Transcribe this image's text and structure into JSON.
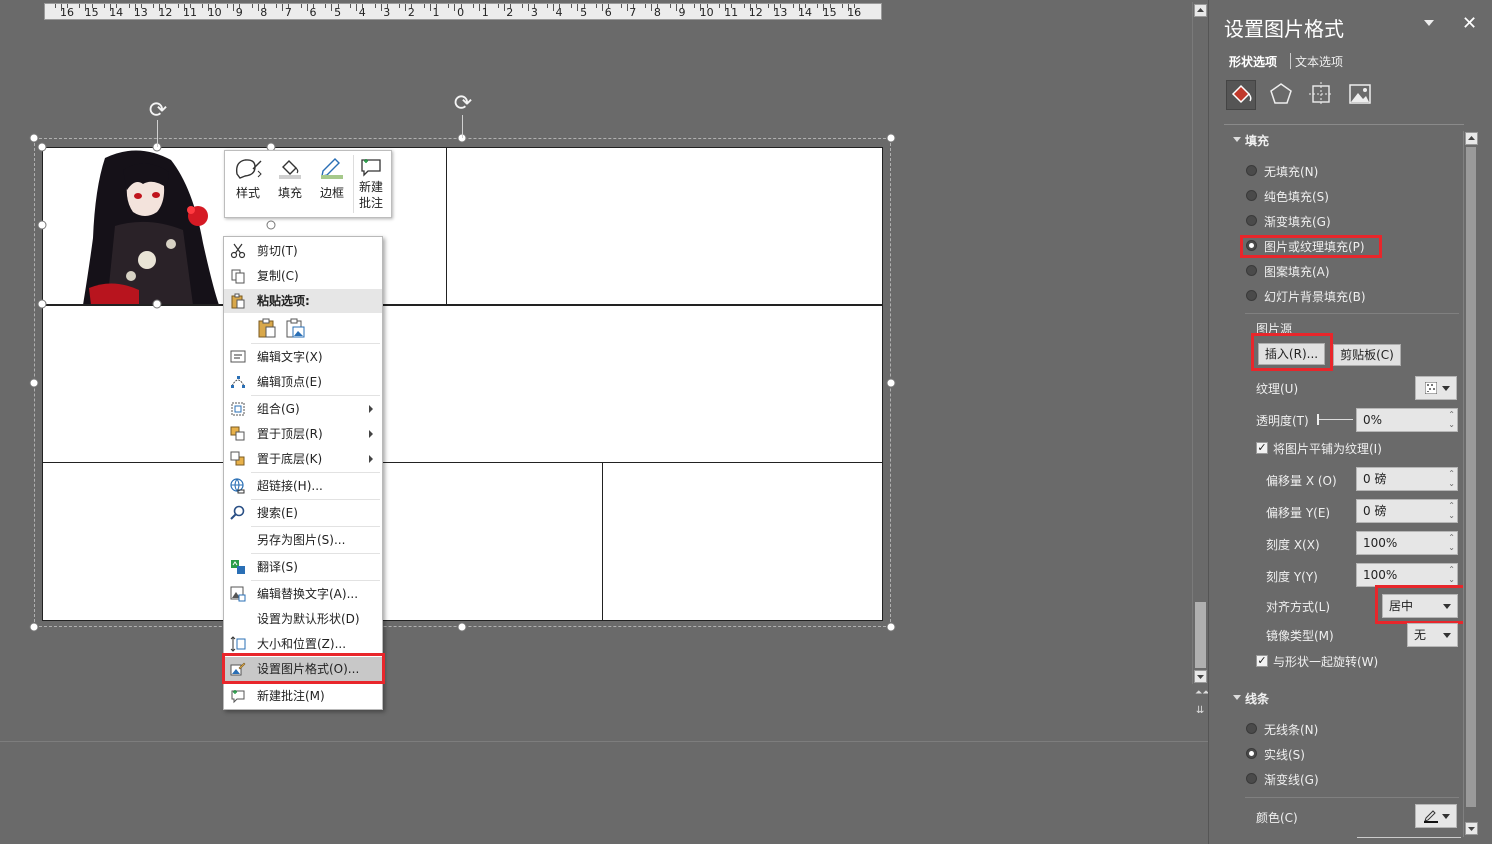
{
  "ruler": {
    "labels": [
      "16",
      "15",
      "14",
      "13",
      "12",
      "11",
      "10",
      "9",
      "8",
      "7",
      "6",
      "5",
      "4",
      "3",
      "2",
      "1",
      "0",
      "1",
      "2",
      "3",
      "4",
      "5",
      "6",
      "7",
      "8",
      "9",
      "10",
      "11",
      "12",
      "13",
      "14",
      "15",
      "16"
    ]
  },
  "mini_toolbar": {
    "style": "样式",
    "fill": "填充",
    "border": "边框",
    "comment_line1": "新建",
    "comment_line2": "批注"
  },
  "context_menu": {
    "cut": "剪切(T)",
    "copy": "复制(C)",
    "paste_options": "粘贴选项:",
    "edit_text": "编辑文字(X)",
    "edit_points": "编辑顶点(E)",
    "group": "组合(G)",
    "bring_front": "置于顶层(R)",
    "send_back": "置于底层(K)",
    "hyperlink": "超链接(H)...",
    "search": "搜索(E)",
    "save_as_picture": "另存为图片(S)...",
    "translate": "翻译(S)",
    "edit_alt_text": "编辑替换文字(A)...",
    "set_default_shape": "设置为默认形状(D)",
    "size_position": "大小和位置(Z)...",
    "format_picture": "设置图片格式(O)...",
    "new_comment": "新建批注(M)"
  },
  "pane": {
    "title": "设置图片格式",
    "tab_shape": "形状选项",
    "tab_text": "文本选项",
    "fill_section": "填充",
    "fill_options": [
      "无填充(N)",
      "纯色填充(S)",
      "渐变填充(G)",
      "图片或纹理填充(P)",
      "图案填充(A)",
      "幻灯片背景填充(B)"
    ],
    "picture_source": "图片源",
    "insert_button": "插入(R)...",
    "clipboard_button": "剪贴板(C)",
    "texture_label": "纹理(U)",
    "transparency_label": "透明度(T)",
    "transparency_value": "0%",
    "tile_label": "将图片平铺为纹理(I)",
    "offset_x_label": "偏移量 X (O)",
    "offset_x_value": "0 磅",
    "offset_y_label": "偏移量 Y(E)",
    "offset_y_value": "0 磅",
    "scale_x_label": "刻度 X(X)",
    "scale_x_value": "100%",
    "scale_y_label": "刻度 Y(Y)",
    "scale_y_value": "100%",
    "alignment_label": "对齐方式(L)",
    "alignment_value": "居中",
    "mirror_label": "镜像类型(M)",
    "mirror_value": "无",
    "rotate_label": "与形状一起旋转(W)",
    "line_section": "线条",
    "line_options": [
      "无线条(N)",
      "实线(S)",
      "渐变线(G)"
    ],
    "color_label": "颜色(C)"
  },
  "colors": {
    "highlight_red": "#e8262b",
    "background": "#6a6a6a"
  }
}
